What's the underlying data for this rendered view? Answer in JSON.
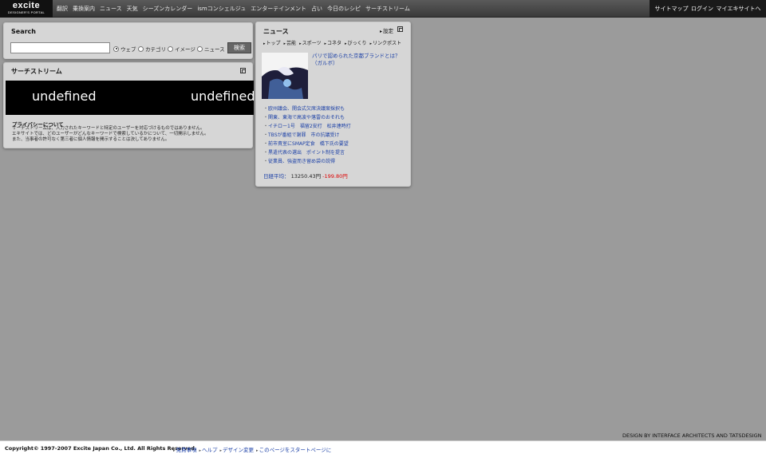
{
  "header": {
    "logo_text": "excite",
    "logo_sub": "DESIGNER'S PORTAL",
    "nav": [
      "翻訳",
      "乗換案内",
      "ニュース",
      "天気",
      "シーズンカレンダー",
      "ismコンシェルジュ",
      "エンターテインメント",
      "占い",
      "今日のレシピ",
      "サーチストリーム"
    ],
    "right_nav": [
      "サイトマップ",
      "ログイン",
      "マイエキサイトへ"
    ]
  },
  "search": {
    "title": "Search",
    "input_value": "",
    "options": [
      "ウェブ",
      "カテゴリ",
      "イメージ",
      "ニュース"
    ],
    "selected": "ウェブ",
    "button_label": "検索"
  },
  "stream": {
    "title": "サーチストリーム",
    "banner_words": [
      "undefined",
      "undefined"
    ],
    "privacy_title": "プライバシーについて",
    "privacy_lines": [
      "サーチストリームは、入力されたキーワードと特定のユーザーを対応づけるものではありません。",
      "エキサイトでは、どのユーザーがどんなキーワードで検索しているかについて、一切開示しません。",
      "また、当事者の許可なく第三者に個人情報を開示することは決してありません。"
    ]
  },
  "news": {
    "title": "ニュース",
    "settings_label": "設定",
    "tabs": [
      "トップ",
      "芸能",
      "スポーツ",
      "コネタ",
      "びっくり",
      "リンクポスト"
    ],
    "headline": "パリで認められた京都ブランドとは？（ガルボ）",
    "items": [
      "欧州議会、開会式欠席決議案採択も",
      "関東、東海で高波や落雷のおそれも",
      "イチロー1号　福留2安打　松井連時打",
      "TBSが番組で謝罪　市の抗議受け",
      "前市貴室にSMAP定食　橋下氏の要望",
      "黒遣代表の選出　ポイント制を提言",
      "従業員、強盗而き留め袋の説得"
    ],
    "nikkei_label": "日経平均：",
    "nikkei_value": "13250.43円",
    "nikkei_change": "-199.80円"
  },
  "credit": "DESIGN BY INTERFACE ARCHITECTS AND TATSDESIGN",
  "footer": {
    "copyright": "Copyright© 1997-2007 Excite Japan Co., Ltd. All Rights Reserved.",
    "links": [
      "免責事項",
      "ヘルプ",
      "デザイン変更",
      "このページをスタートページに"
    ]
  }
}
